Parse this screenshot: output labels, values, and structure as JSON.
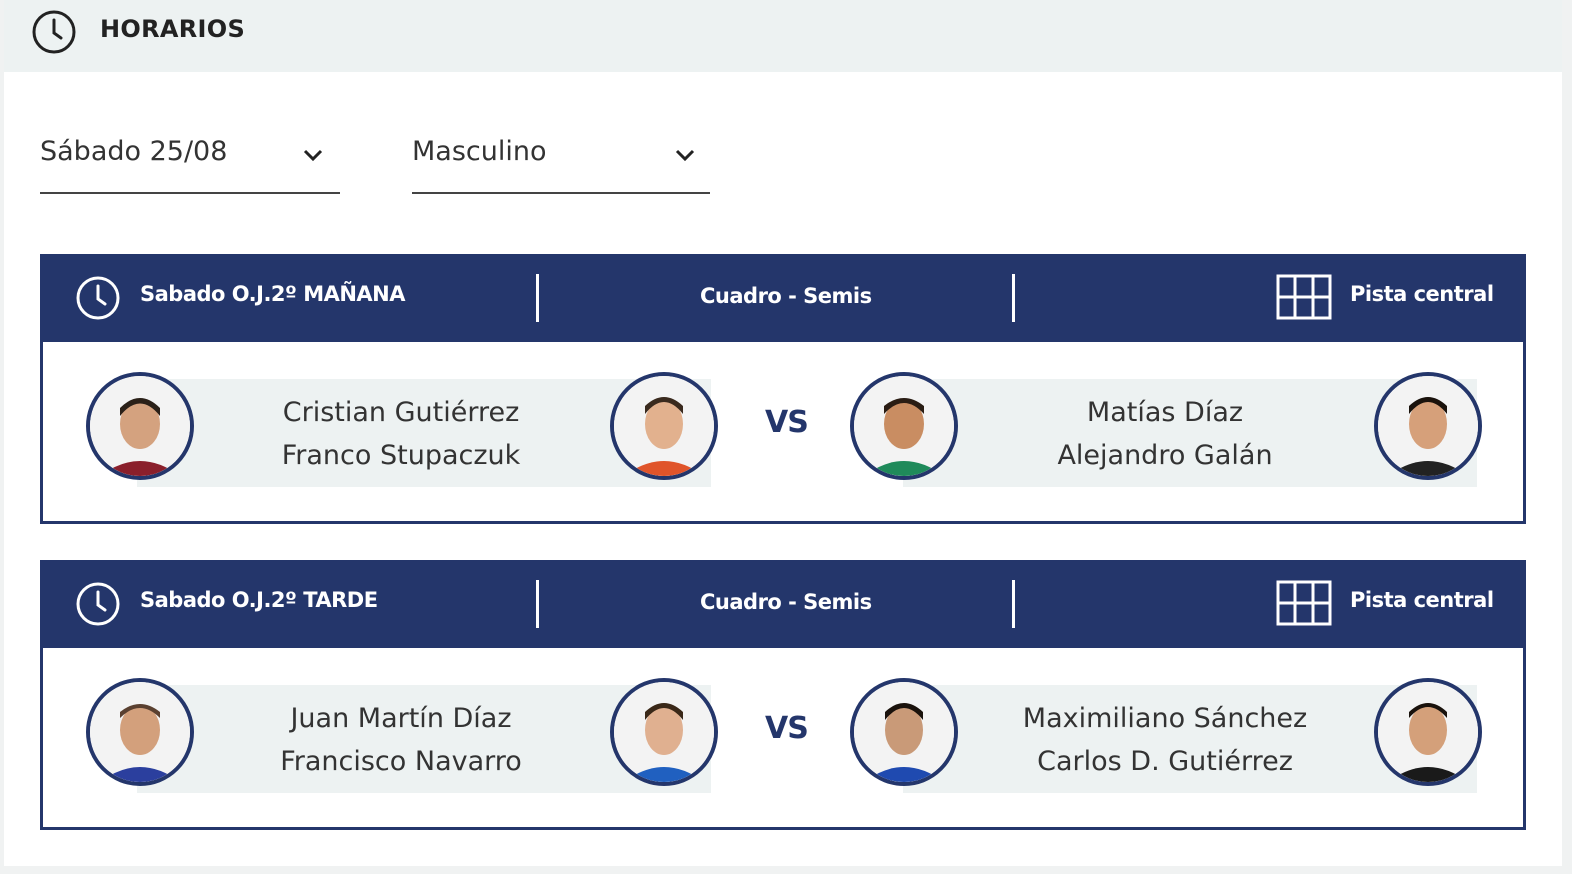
{
  "header": {
    "title": "HORARIOS",
    "icon": "clock-icon"
  },
  "filters": {
    "date": {
      "value": "Sábado 25/08"
    },
    "category": {
      "value": "Masculino"
    }
  },
  "matches": [
    {
      "time": "Sabado O.J.2º MAÑANA",
      "round": "Cuadro - Semis",
      "court": "Pista central",
      "team1": {
        "player1": "Cristian Gutiérrez",
        "player2": "Franco Stupaczuk"
      },
      "vs": "VS",
      "team2": {
        "player1": "Matías Díaz",
        "player2": "Alejandro Galán"
      },
      "shirts": [
        "#8a1f2b",
        "#e0542a",
        "#1f8a5a",
        "#222222"
      ]
    },
    {
      "time": "Sabado O.J.2º TARDE",
      "round": "Cuadro - Semis",
      "court": "Pista central",
      "team1": {
        "player1": "Juan Martín Díaz",
        "player2": "Francisco Navarro"
      },
      "vs": "VS",
      "team2": {
        "player1": "Maximiliano Sánchez",
        "player2": "Carlos D. Gutiérrez"
      },
      "shirts": [
        "#2b3f9e",
        "#2060c0",
        "#1f4ab0",
        "#1a1a1a"
      ]
    }
  ],
  "colors": {
    "brand": "#24366b",
    "band": "#edf2f2",
    "topbar": "#edf2f2"
  }
}
